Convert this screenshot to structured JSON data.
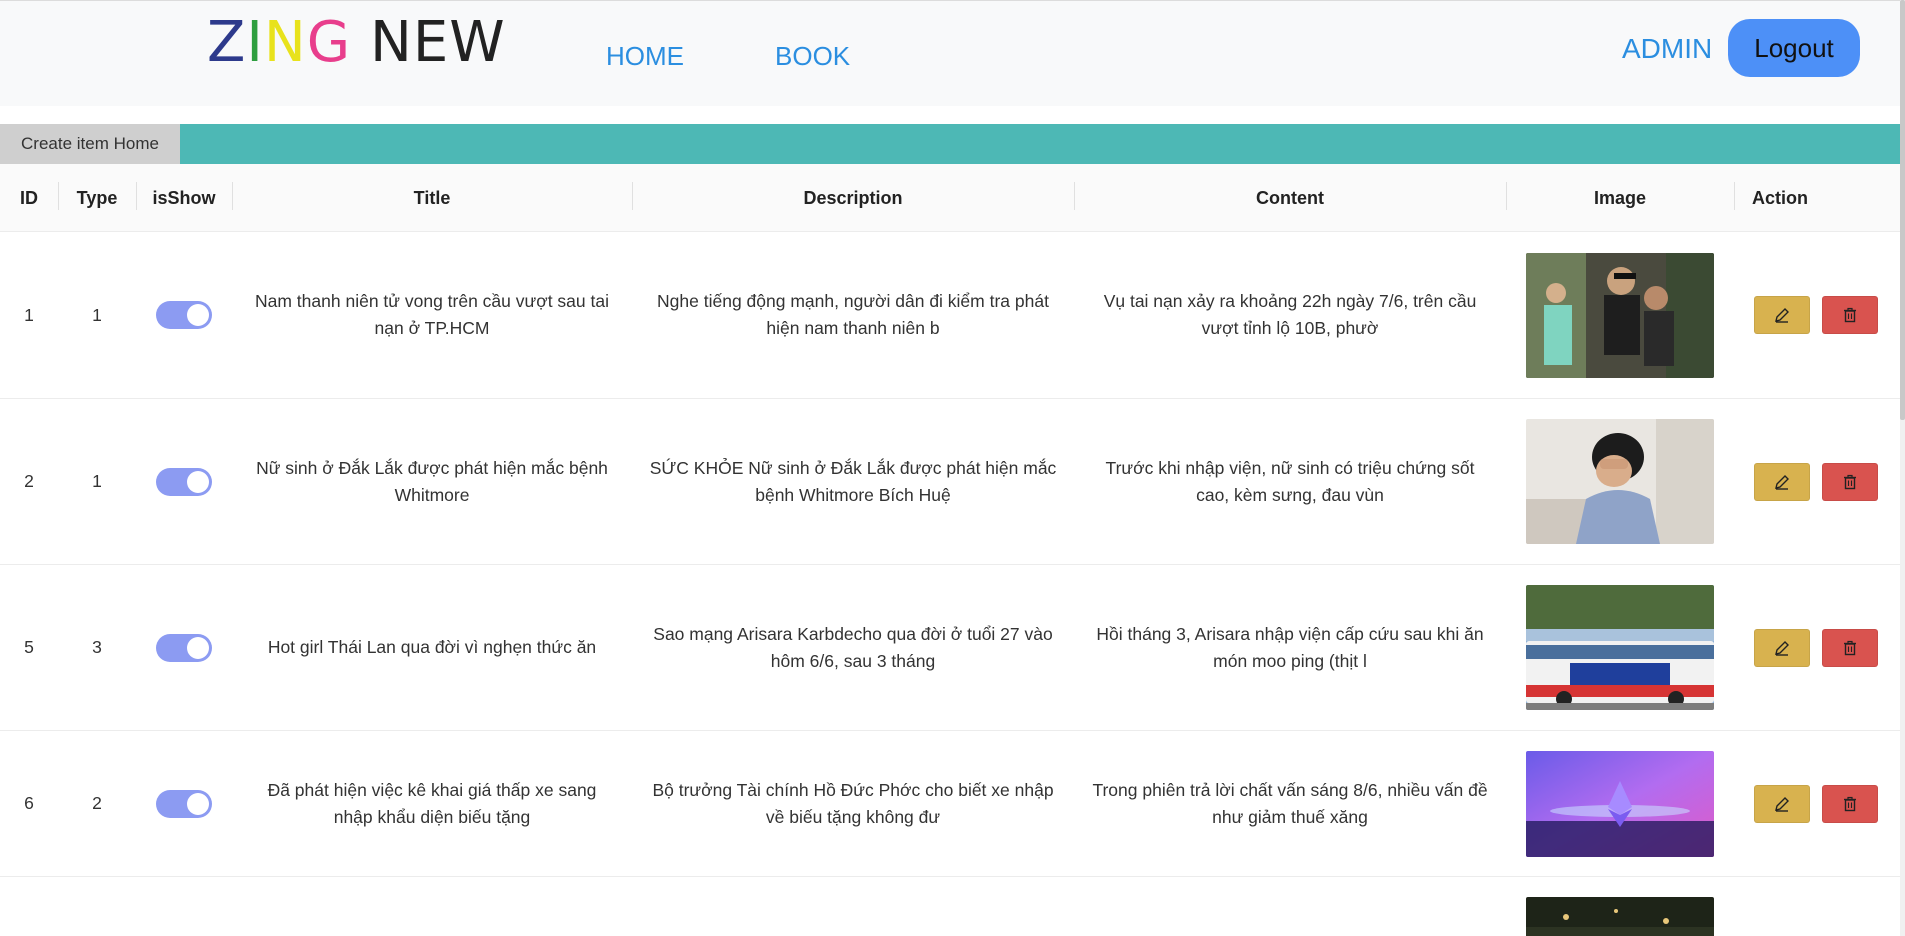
{
  "brand": {
    "letters": [
      {
        "char": "Z",
        "color": "#2d3a8c"
      },
      {
        "char": "I",
        "color": "#2e9e3f"
      },
      {
        "char": "N",
        "color": "#e8e21c"
      },
      {
        "char": "G",
        "color": "#e83e8c"
      },
      {
        "char": " ",
        "color": "#222222"
      },
      {
        "char": "N",
        "color": "#222222"
      },
      {
        "char": "E",
        "color": "#222222"
      },
      {
        "char": "W",
        "color": "#222222"
      }
    ]
  },
  "nav": {
    "home": "HOME",
    "book": "BOOK",
    "admin": "ADMIN",
    "logout": "Logout"
  },
  "toolbar": {
    "create_label": "Create item Home"
  },
  "table": {
    "headers": [
      "ID",
      "Type",
      "isShow",
      "Title",
      "Description",
      "Content",
      "Image",
      "Action"
    ],
    "rows": [
      {
        "id": "1",
        "type": "1",
        "is_show": true,
        "title": "Nam thanh niên tử vong trên cầu vượt sau tai nạn ở TP.HCM",
        "description": "Nghe tiếng động mạnh, người dân đi kiểm tra phát hiện nam thanh niên b",
        "content": "Vụ tai nạn xảy ra khoảng 22h ngày 7/6, trên cầu vượt tỉnh lộ 10B, phườ",
        "image": "photo-couple-selfie"
      },
      {
        "id": "2",
        "type": "1",
        "is_show": true,
        "title": "Nữ sinh ở Đắk Lắk được phát hiện mắc bệnh Whitmore",
        "description": "SỨC KHỎE Nữ sinh ở Đắk Lắk được phát hiện mắc bệnh Whitmore Bích Huệ",
        "content": "Trước khi nhập viện, nữ sinh có triệu chứng sốt cao, kèm sưng, đau vùn",
        "image": "photo-man-headache"
      },
      {
        "id": "5",
        "type": "3",
        "is_show": true,
        "title": "Hot girl Thái Lan qua đời vì nghẹn thức ăn",
        "description": "Sao mạng Arisara Karbdecho qua đời ở tuổi 27 vào hôm 6/6, sau 3 tháng",
        "content": "Hồi tháng 3, Arisara nhập viện cấp cứu sau khi ăn món moo ping (thịt l",
        "image": "photo-city-bus"
      },
      {
        "id": "6",
        "type": "2",
        "is_show": true,
        "title": "Đã phát hiện việc kê khai giá thấp xe sang nhập khẩu diện biếu tặng",
        "description": "Bộ trưởng Tài chính Hồ Đức Phớc cho biết xe nhập về biếu tặng không đư",
        "content": "Trong phiên trả lời chất vấn sáng 8/6, nhiều vấn đề như giảm thuế xăng",
        "image": "photo-ethereum-glow"
      }
    ]
  },
  "colors": {
    "accent": "#2b8ee0",
    "teal_bar": "#4db8b5",
    "toggle_on": "#8c9bf2",
    "edit": "#d8b24f",
    "delete": "#d9534f"
  }
}
